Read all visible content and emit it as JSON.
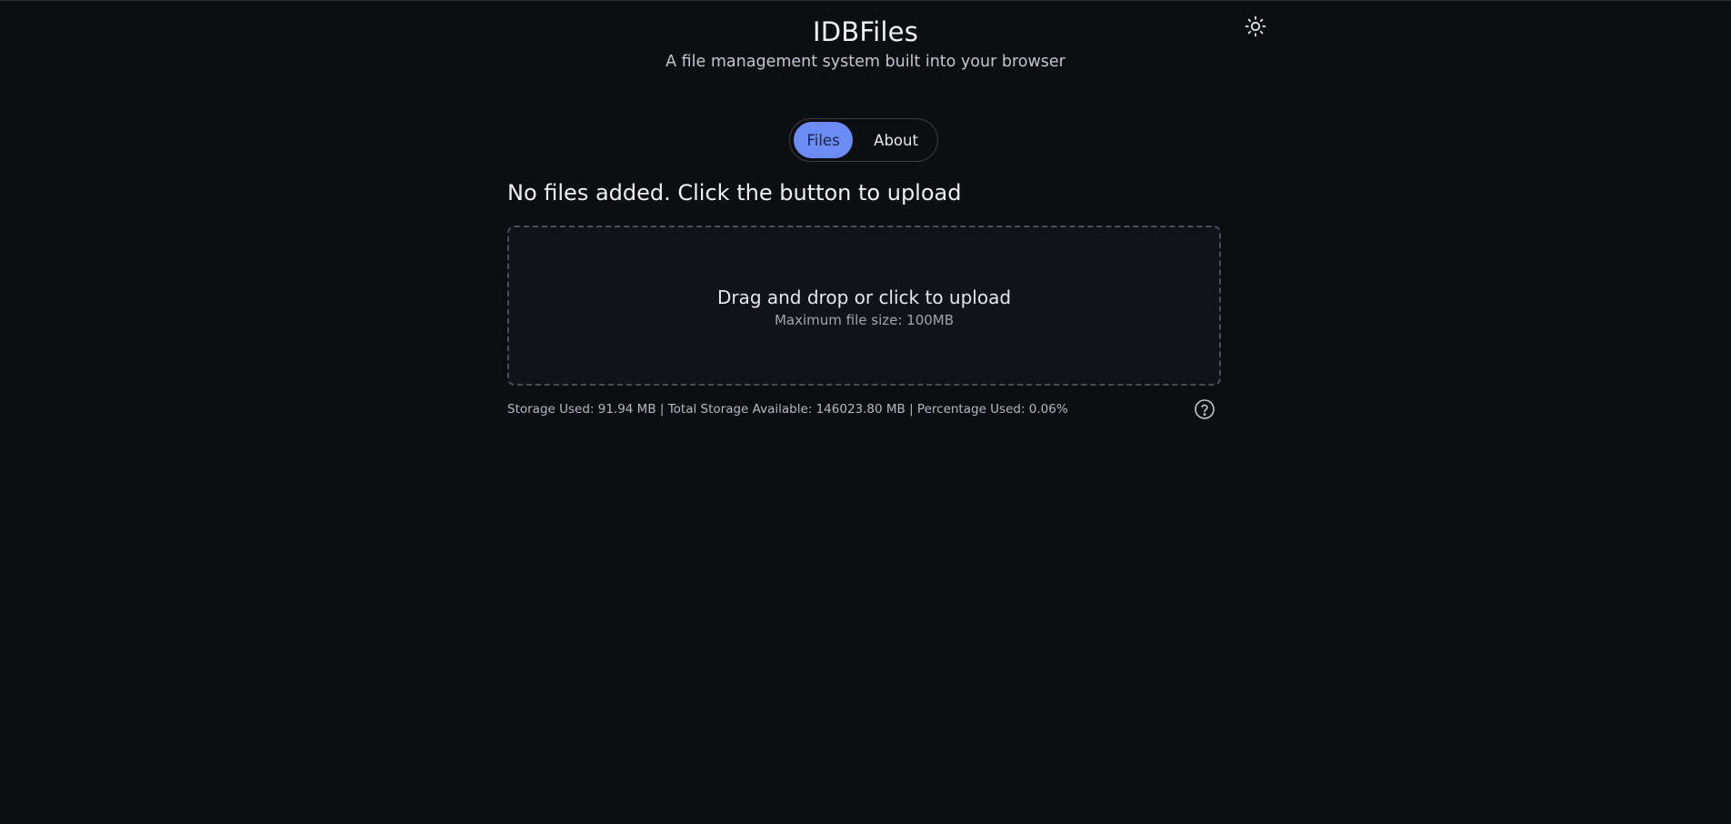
{
  "app": {
    "title": "IDBFiles",
    "subtitle": "A file management system built into your browser"
  },
  "theme_toggle": {
    "icon": "sun-icon"
  },
  "tabs": [
    {
      "label": "Files",
      "active": true
    },
    {
      "label": "About",
      "active": false
    }
  ],
  "main": {
    "empty_message": "No files added. Click the button to upload",
    "dropzone": {
      "title": "Drag and drop or click to upload",
      "subtitle": "Maximum file size: 100MB"
    },
    "storage_info": "Storage Used: 91.94 MB | Total Storage Available: 146023.80 MB | Percentage Used: 0.06%",
    "help_icon": "question-circle-icon"
  },
  "colors": {
    "background": "#0c0e12",
    "accent": "#6b8cf5",
    "dropzone_background": "#101318"
  }
}
